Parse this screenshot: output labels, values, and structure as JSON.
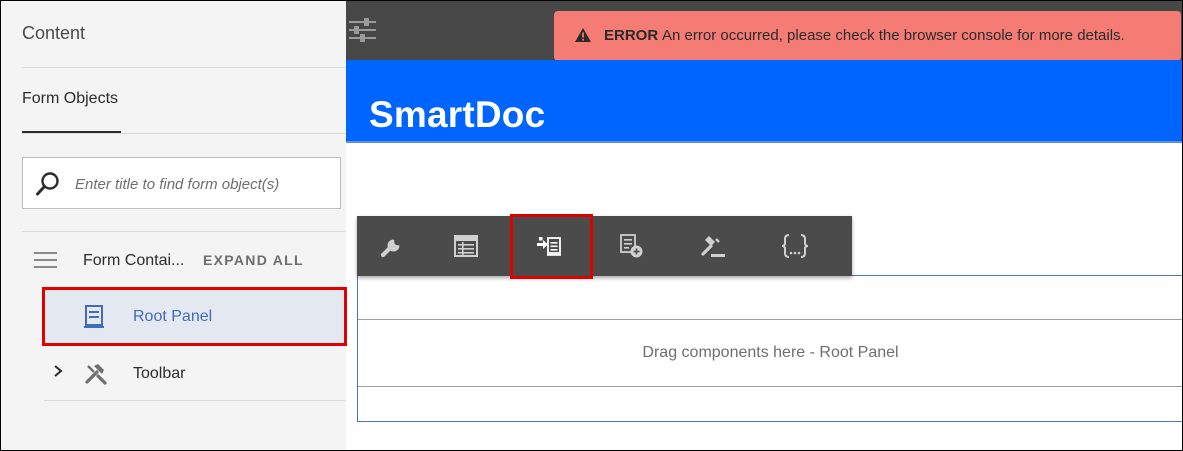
{
  "sidebar": {
    "title": "Content",
    "tabs": [
      {
        "label": "Form Objects",
        "active": true
      }
    ],
    "search": {
      "placeholder": "Enter title to find form object(s)",
      "value": ""
    },
    "tree": {
      "root_label": "Form Contai...",
      "expand_all_label": "EXPAND ALL",
      "items": [
        {
          "label": "Root Panel",
          "icon": "panel-icon",
          "selected": true
        },
        {
          "label": "Toolbar",
          "icon": "toolbar-tools-icon",
          "expandable": true
        }
      ]
    }
  },
  "topbar": {
    "icon": "properties-sliders-icon"
  },
  "error_toast": {
    "label": "ERROR",
    "message": "An error occurred, please check the browser console for more details.",
    "icon": "warning-icon",
    "color": "#f47c75"
  },
  "brand": {
    "title": "SmartDoc",
    "color": "#0065ff"
  },
  "canvas": {
    "drop_zone_text": "Drag components here - Root Panel"
  },
  "toolbar": {
    "buttons": [
      {
        "icon": "wrench-icon",
        "action": "configure"
      },
      {
        "icon": "table-list-icon",
        "action": "panel layout"
      },
      {
        "icon": "insert-panel-icon",
        "action": "insert",
        "highlighted": true
      },
      {
        "icon": "add-form-item-icon",
        "action": "add"
      },
      {
        "icon": "gavel-rules-icon",
        "action": "rules"
      },
      {
        "icon": "curly-braces-icon",
        "action": "code"
      }
    ]
  },
  "highlight_color": "#e10000"
}
